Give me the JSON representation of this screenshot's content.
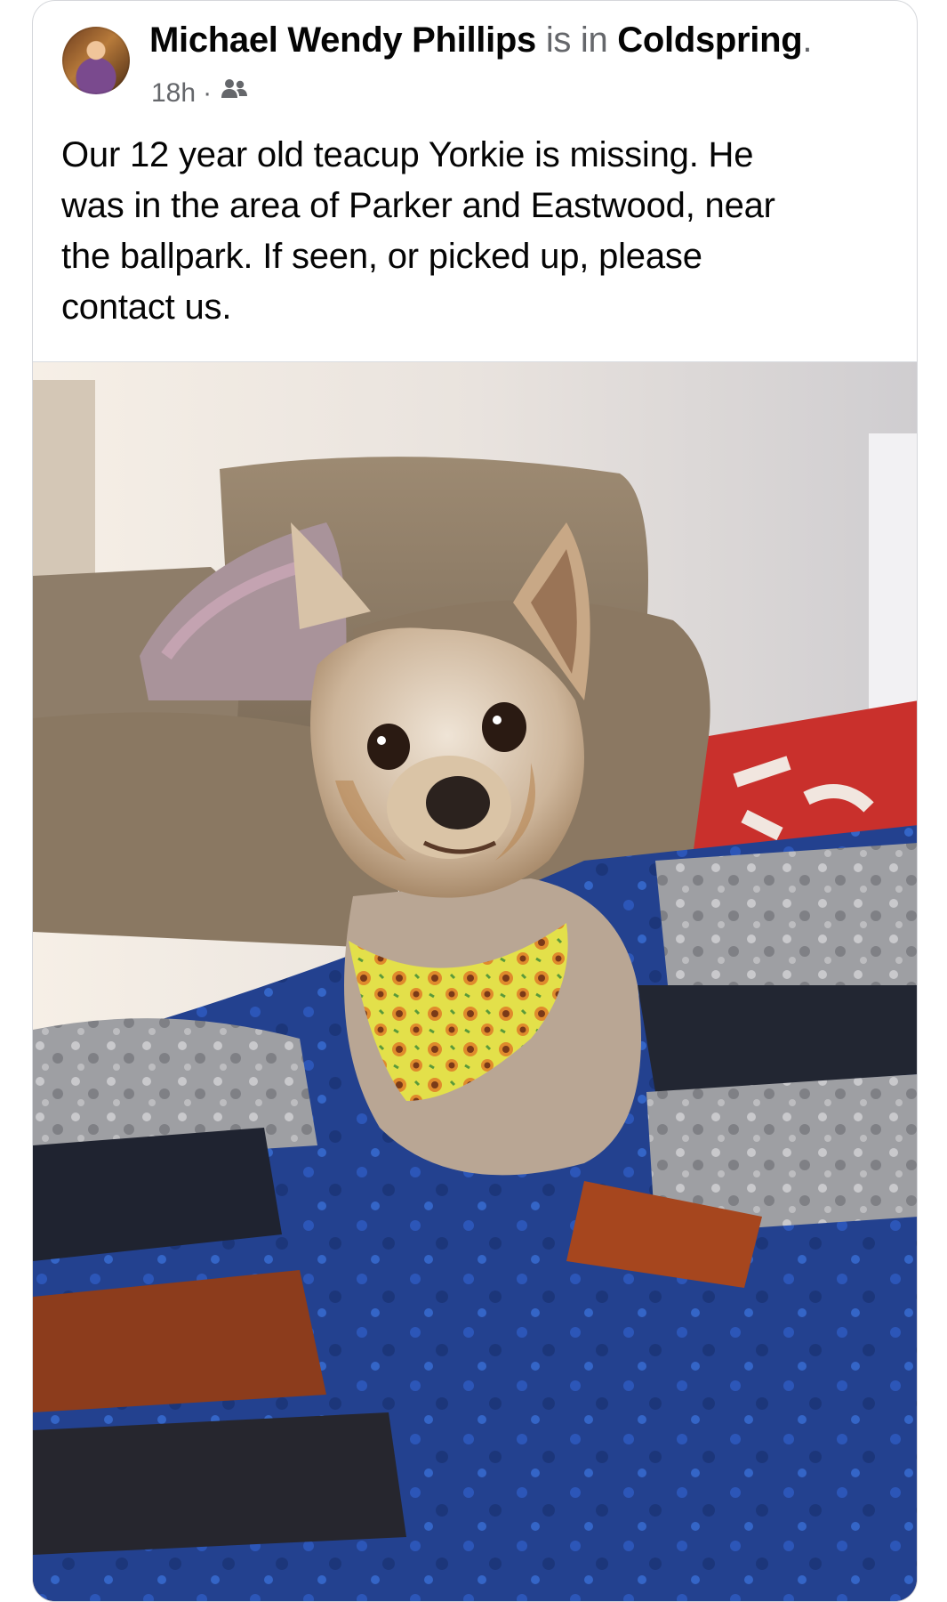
{
  "post": {
    "author": "Michael Wendy Phillips",
    "connector": "is in",
    "location": "Coldspring",
    "period": ".",
    "time": "18h",
    "separator": "·",
    "audience_icon": "friends-icon",
    "text_lines": [
      "Our 12 year old teacup Yorkie is missing. He",
      "was in the area of Parker and Eastwood, near",
      "the ballpark. If seen, or picked up, please",
      "contact us."
    ],
    "photo_subject": "Yorkie dog with sunflower bandana on blanket"
  },
  "colors": {
    "text_primary": "#050505",
    "text_secondary": "#65676b",
    "card_border": "#d5d7db"
  }
}
